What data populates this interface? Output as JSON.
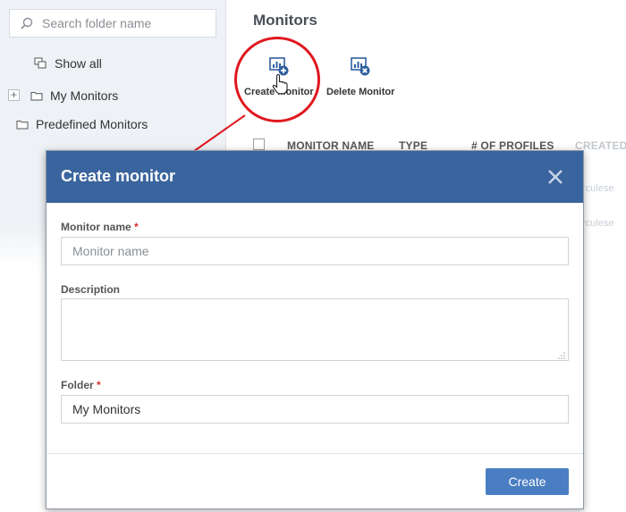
{
  "sidebar": {
    "search_placeholder": "Search folder name",
    "show_all": "Show all",
    "expander": "+",
    "items": [
      {
        "label": "My Monitors"
      },
      {
        "label": "Predefined Monitors"
      }
    ]
  },
  "main": {
    "title": "Monitors",
    "toolbar": {
      "create": "Create Monitor",
      "delete": "Delete Monitor"
    },
    "table": {
      "columns": [
        "MONITOR NAME",
        "TYPE",
        "# OF PROFILES",
        "CREATED"
      ]
    },
    "ghost_rows": [
      "rculese",
      "rculese"
    ]
  },
  "dialog": {
    "title": "Create monitor",
    "monitor_name_label": "Monitor name",
    "monitor_name_placeholder": "Monitor name",
    "description_label": "Description",
    "folder_label": "Folder",
    "folder_value": "My Monitors",
    "required_mark": "*",
    "create_button": "Create"
  },
  "colors": {
    "dialog_header": "#3a649d",
    "primary_button": "#4a7ec2",
    "highlight": "#e0171f",
    "required": "#d0312d",
    "icon_blue": "#2f5f9e"
  },
  "icons": [
    "search-icon",
    "show-all-icon",
    "folder-icon",
    "create-monitor-icon",
    "delete-monitor-icon",
    "hand-cursor-icon",
    "close-icon"
  ]
}
